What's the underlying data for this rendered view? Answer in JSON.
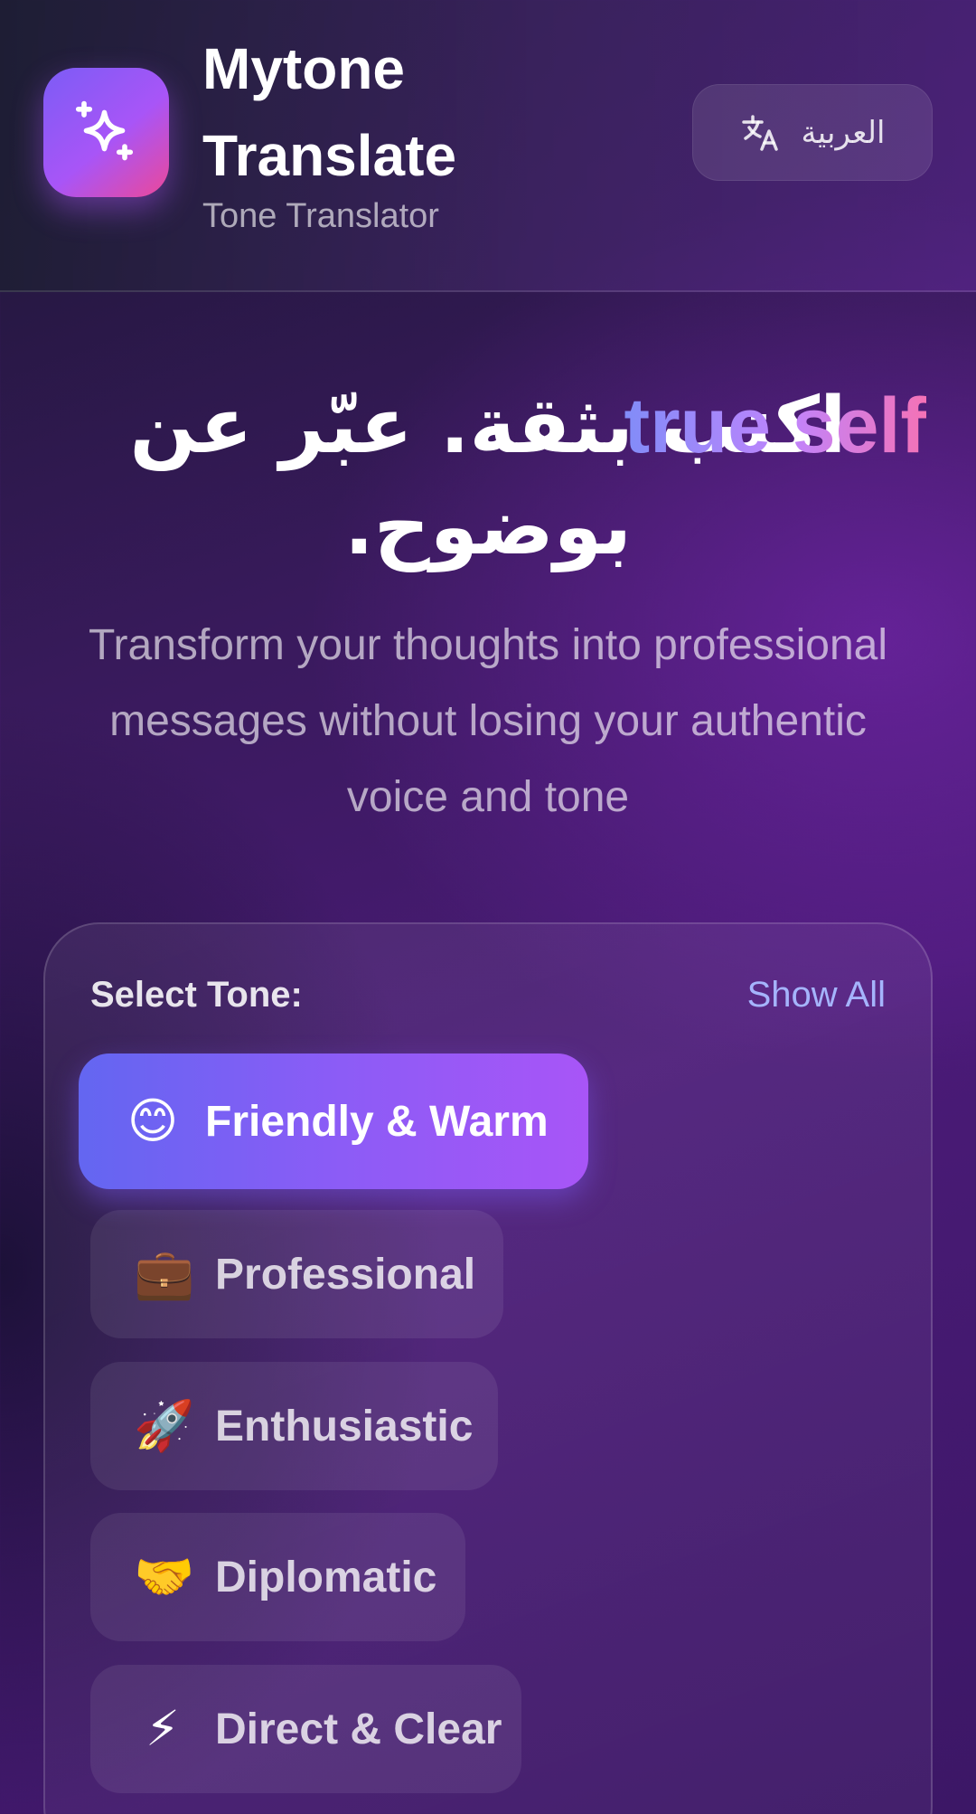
{
  "header": {
    "app_title": "Mytone Translate",
    "app_subtitle": "Tone Translator",
    "logo_icon": "sparkles-icon",
    "language_button": {
      "icon": "translate-icon",
      "label": "العربية"
    }
  },
  "hero": {
    "title_arabic": "اكتب بثقة. عبّر عن بوضوح.",
    "title_accent": "true self",
    "description": "Transform your thoughts into professional messages without losing your authentic voice and tone"
  },
  "tone_selector": {
    "heading": "Select Tone:",
    "show_all_label": "Show All",
    "selected": "Friendly & Warm",
    "options": [
      {
        "emoji": "😊",
        "label": "Friendly & Warm"
      },
      {
        "emoji": "💼",
        "label": "Professional"
      },
      {
        "emoji": "🚀",
        "label": "Enthusiastic"
      },
      {
        "emoji": "🤝",
        "label": "Diplomatic"
      },
      {
        "emoji": "⚡",
        "label": "Direct & Clear"
      }
    ]
  },
  "colors": {
    "accent_gradient_start": "#6366f1",
    "accent_gradient_end": "#a855f7",
    "hero_accent_start": "#818cf8",
    "hero_accent_end": "#f472b6",
    "link": "#a5b4fc"
  }
}
